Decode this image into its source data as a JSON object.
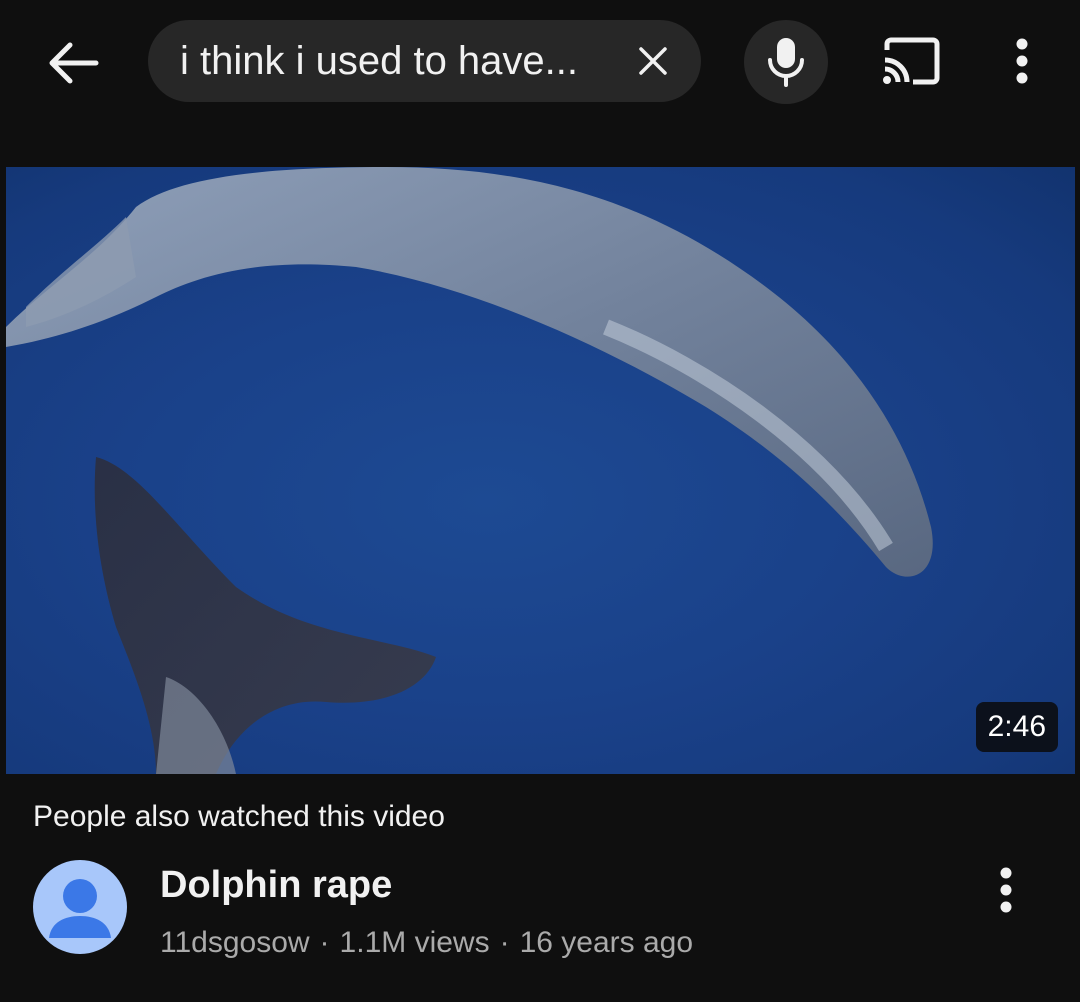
{
  "header": {
    "back_icon": "arrow-left-icon",
    "search": {
      "query": "i think i used to have...",
      "clear_icon": "close-icon"
    },
    "mic_icon": "microphone-icon",
    "cast_icon": "cast-icon",
    "more_icon": "more-vertical-icon"
  },
  "video": {
    "duration": "2:46",
    "thumbnail_icon": "video-thumbnail"
  },
  "section": {
    "label": "People also watched this video"
  },
  "result": {
    "title": "Dolphin rape",
    "channel": "11dsgosow",
    "views": "1.1M views",
    "age": "16 years ago",
    "separator": "·",
    "avatar_icon": "default-avatar-icon",
    "more_icon": "more-vertical-icon"
  },
  "colors": {
    "background": "#0f0f0f",
    "pill": "#272727",
    "text": "#f1f1f1",
    "secondary_text": "#aaaaaa",
    "avatar_bg": "#a8c7fa",
    "avatar_fg": "#3b78e7",
    "water": "#1a4189"
  }
}
